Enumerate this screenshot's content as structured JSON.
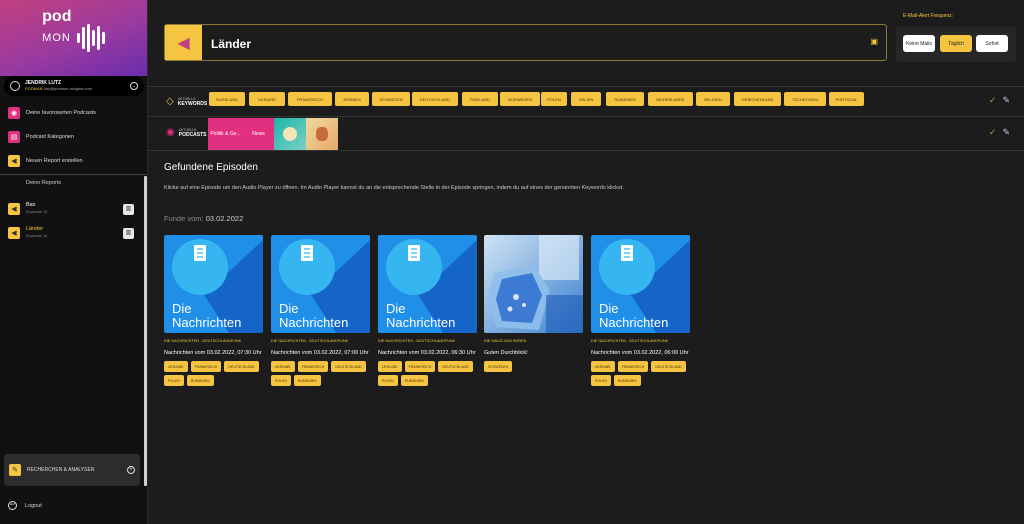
{
  "brand": {
    "pod": "pod",
    "mon": "MON"
  },
  "user": {
    "name": "JENDRIK LUTZ",
    "tag": "PODMAN",
    "email": "lutz@podmon-insights.com"
  },
  "nav": [
    {
      "label": "Deine favorisierten Podcasts"
    },
    {
      "label": "Podcast Kategorien"
    },
    {
      "label": "Neuen Report erstellen"
    }
  ],
  "reports": {
    "heading": "Deine Reports",
    "items": [
      {
        "name": "Bax",
        "sub": "Keywords: 13"
      },
      {
        "name": "Länder",
        "sub": "Keywords: 16"
      }
    ]
  },
  "recherche": {
    "label": "RECHERCHEN & ANALYSEN"
  },
  "logout": {
    "label": "Logout"
  },
  "report_title": "Länder",
  "alert": {
    "label": "E-Mail-Alert Frequenz:",
    "options": [
      "Keine Mails",
      "Täglich",
      "Sofort"
    ],
    "selected": "Täglich"
  },
  "keywords_row": {
    "label_small": "AKTUELLE",
    "label_big": "KEYWORDS",
    "items": [
      "RUSSLAND",
      "UKRAINE",
      "FRANKREICH",
      "SPANIEN",
      "SCHWEDEN",
      "DEUTSCHLAND",
      "FINNLAND",
      "NORWEGEN",
      "POLEN",
      "ITALIEN",
      "RUMÄNIEN",
      "NIEDERLANDE",
      "BELGIEN",
      "GRIECHENLAND",
      "TSCHECHIEN",
      "PORTUGAL"
    ]
  },
  "podcasts_row": {
    "label_small": "AKTUELLE",
    "label_big": "PODCASTS",
    "items": [
      "Politik & Ge...",
      "News",
      "",
      ""
    ]
  },
  "episodes": {
    "heading": "Gefundene Episoden",
    "description": "Klicke auf eine Episode um den Audio Player zu öffnen. Im Audio Player kannst du an die entsprechende Stelle in der Episode springen, indem du auf eines der genannten Keywords klickst.",
    "found_label": "Funde vom:",
    "found_date": "03.02.2022",
    "cover_text": [
      "Die",
      "Nachrichten"
    ],
    "cards": [
      {
        "source": "DIE NACHRICHTEN - DEUTSCHLANDFUNK",
        "title": "Nachrichten vom 03.02.2022, 07:30 Uhr",
        "tags": [
          "UKRAINE",
          "FRANKREICH",
          "DEUTSCHLAND",
          "POLEN",
          "RUMÄNIEN"
        ]
      },
      {
        "source": "DIE NACHRICHTEN - DEUTSCHLANDFUNK",
        "title": "Nachrichten vom 03.02.2022, 07:00 Uhr",
        "tags": [
          "UKRAINE",
          "FRANKREICH",
          "DEUTSCHLAND",
          "POLEN",
          "RUMÄNIEN"
        ]
      },
      {
        "source": "DIE NACHRICHTEN - DEUTSCHLANDFUNK",
        "title": "Nachrichten vom 03.02.2022, 06:30 Uhr",
        "tags": [
          "UKRAINE",
          "FRANKREICH",
          "DEUTSCHLAND",
          "POLEN",
          "RUMÄNIEN"
        ]
      },
      {
        "source": "DIE MAUS ZUM HÖREN",
        "title": "Guten Durchblick!",
        "tags": [
          "SCHWEDEN"
        ]
      },
      {
        "source": "DIE NACHRICHTEN - DEUTSCHLANDFUNK",
        "title": "Nachrichten vom 03.02.2022, 06:00 Uhr",
        "tags": [
          "UKRAINE",
          "FRANKREICH",
          "DEUTSCHLAND",
          "POLEN",
          "RUMÄNIEN"
        ]
      }
    ]
  },
  "colors": {
    "accent": "#f5c542",
    "brand_pink": "#e0307f",
    "check": "#6abf3a"
  },
  "icons": {
    "title": "megaphone-icon",
    "save": "save-icon",
    "keywords": "tag-icon",
    "podcasts": "podcast-icon",
    "confirm": "check-icon",
    "edit": "pencil-icon"
  }
}
